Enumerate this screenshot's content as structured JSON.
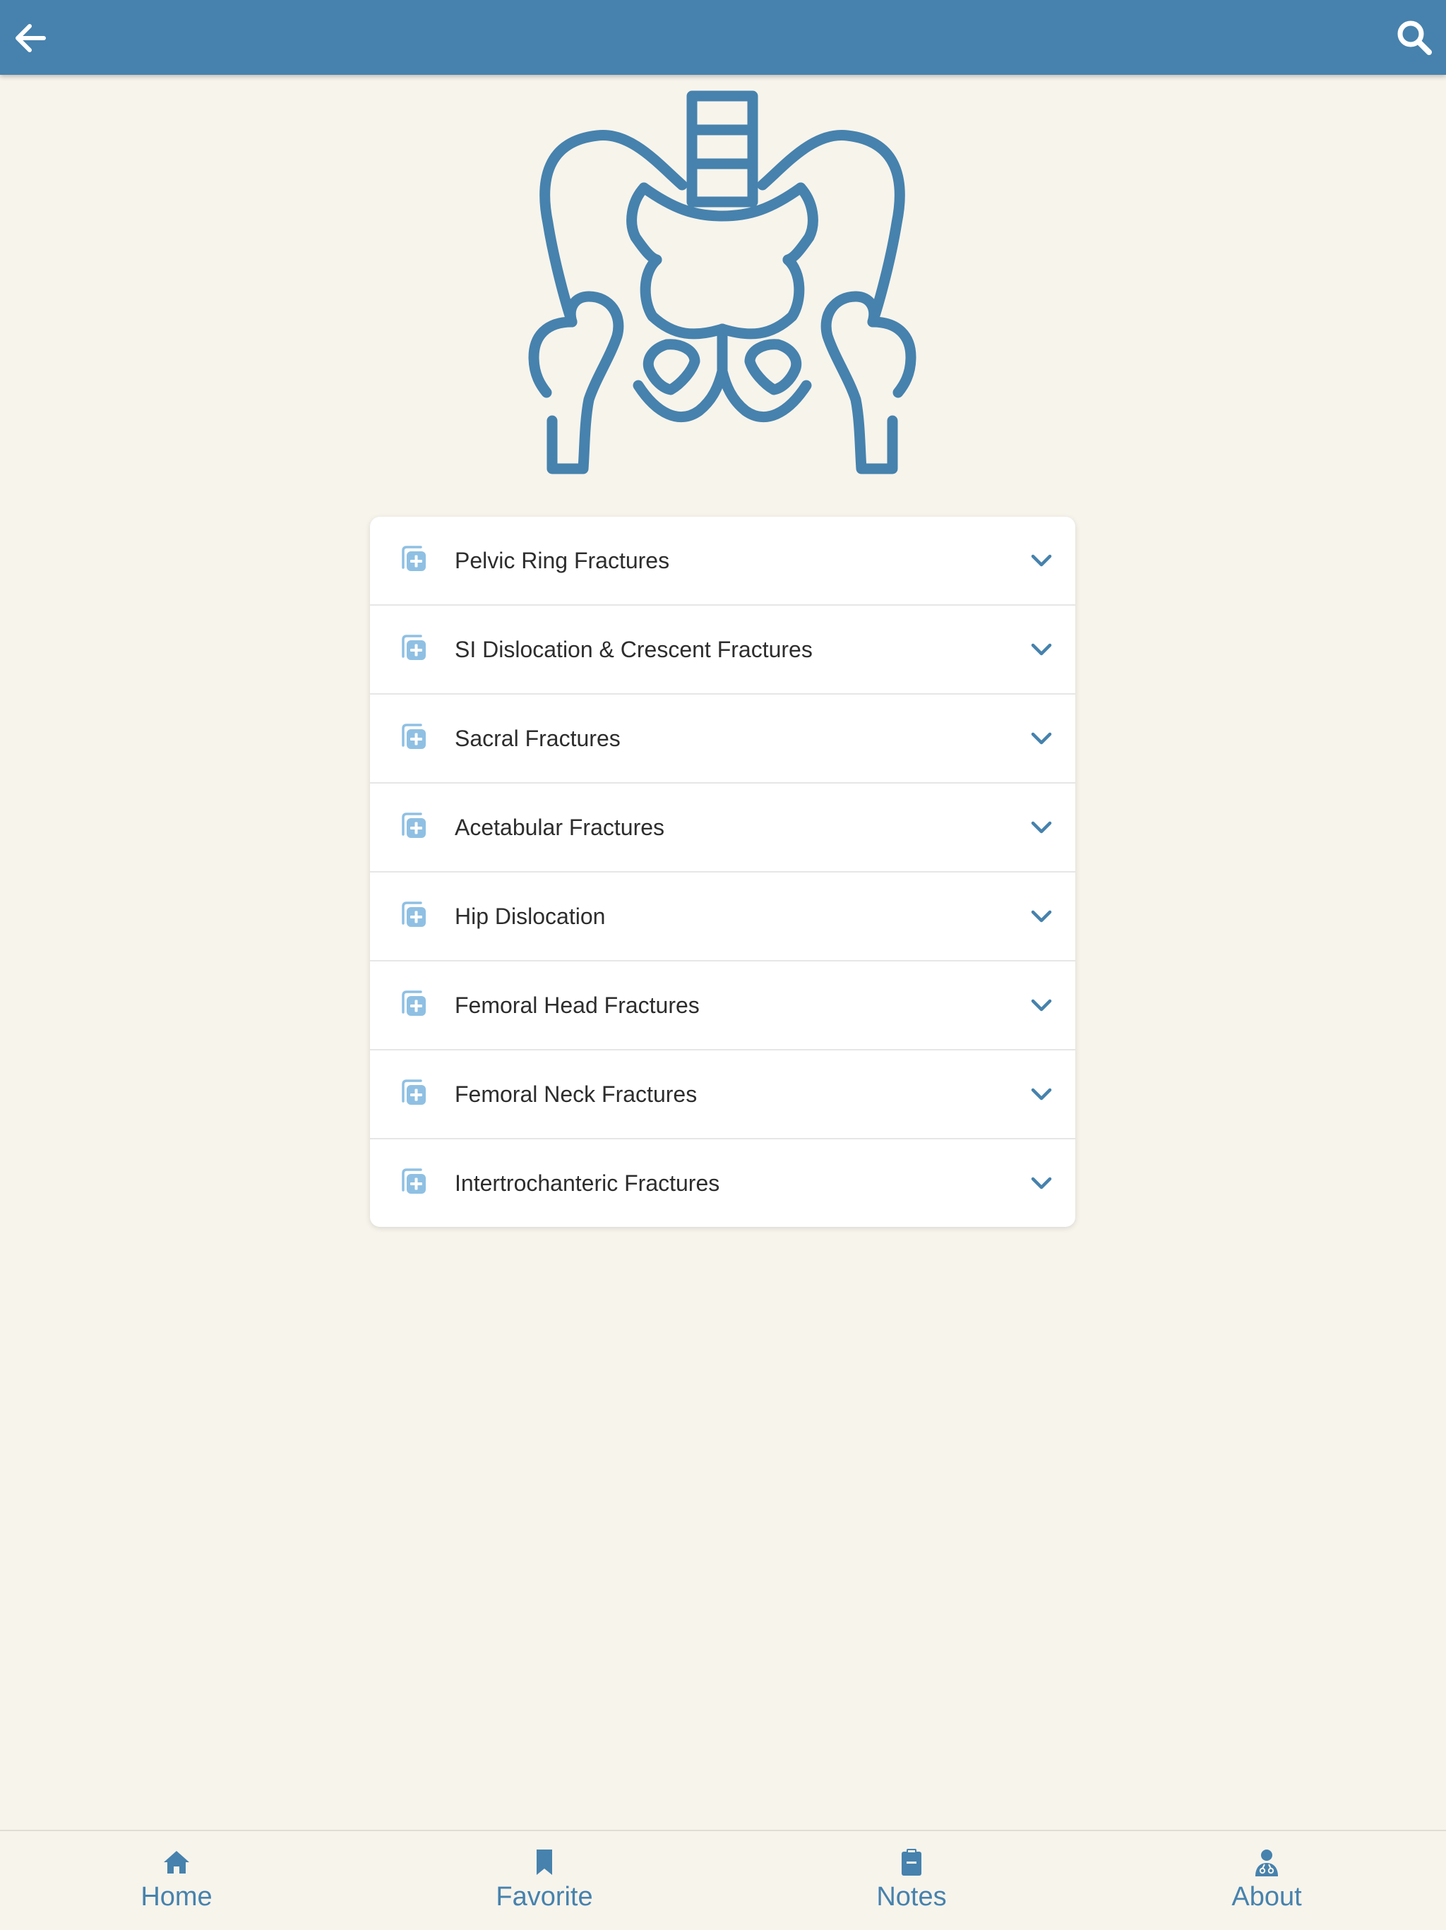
{
  "colors": {
    "primary": "#4682ad",
    "background": "#f7f4ec",
    "card": "#ffffff",
    "icon_light": "#7fb5dd",
    "text": "#2d2d2d"
  },
  "header": {
    "back_icon": "arrow-left-icon",
    "search_icon": "search-icon"
  },
  "hero": {
    "icon": "pelvis-icon"
  },
  "topics": [
    {
      "label": "Pelvic Ring Fractures",
      "icon": "medical-plus-icon"
    },
    {
      "label": "SI Dislocation & Crescent Fractures",
      "icon": "medical-plus-icon"
    },
    {
      "label": "Sacral Fractures",
      "icon": "medical-plus-icon"
    },
    {
      "label": "Acetabular Fractures",
      "icon": "medical-plus-icon"
    },
    {
      "label": "Hip Dislocation",
      "icon": "medical-plus-icon"
    },
    {
      "label": "Femoral Head Fractures",
      "icon": "medical-plus-icon"
    },
    {
      "label": "Femoral Neck Fractures",
      "icon": "medical-plus-icon"
    },
    {
      "label": "Intertrochanteric Fractures",
      "icon": "medical-plus-icon"
    }
  ],
  "nav": [
    {
      "label": "Home",
      "icon": "home-icon"
    },
    {
      "label": "Favorite",
      "icon": "bookmark-icon"
    },
    {
      "label": "Notes",
      "icon": "clipboard-icon"
    },
    {
      "label": "About",
      "icon": "doctor-icon"
    }
  ]
}
